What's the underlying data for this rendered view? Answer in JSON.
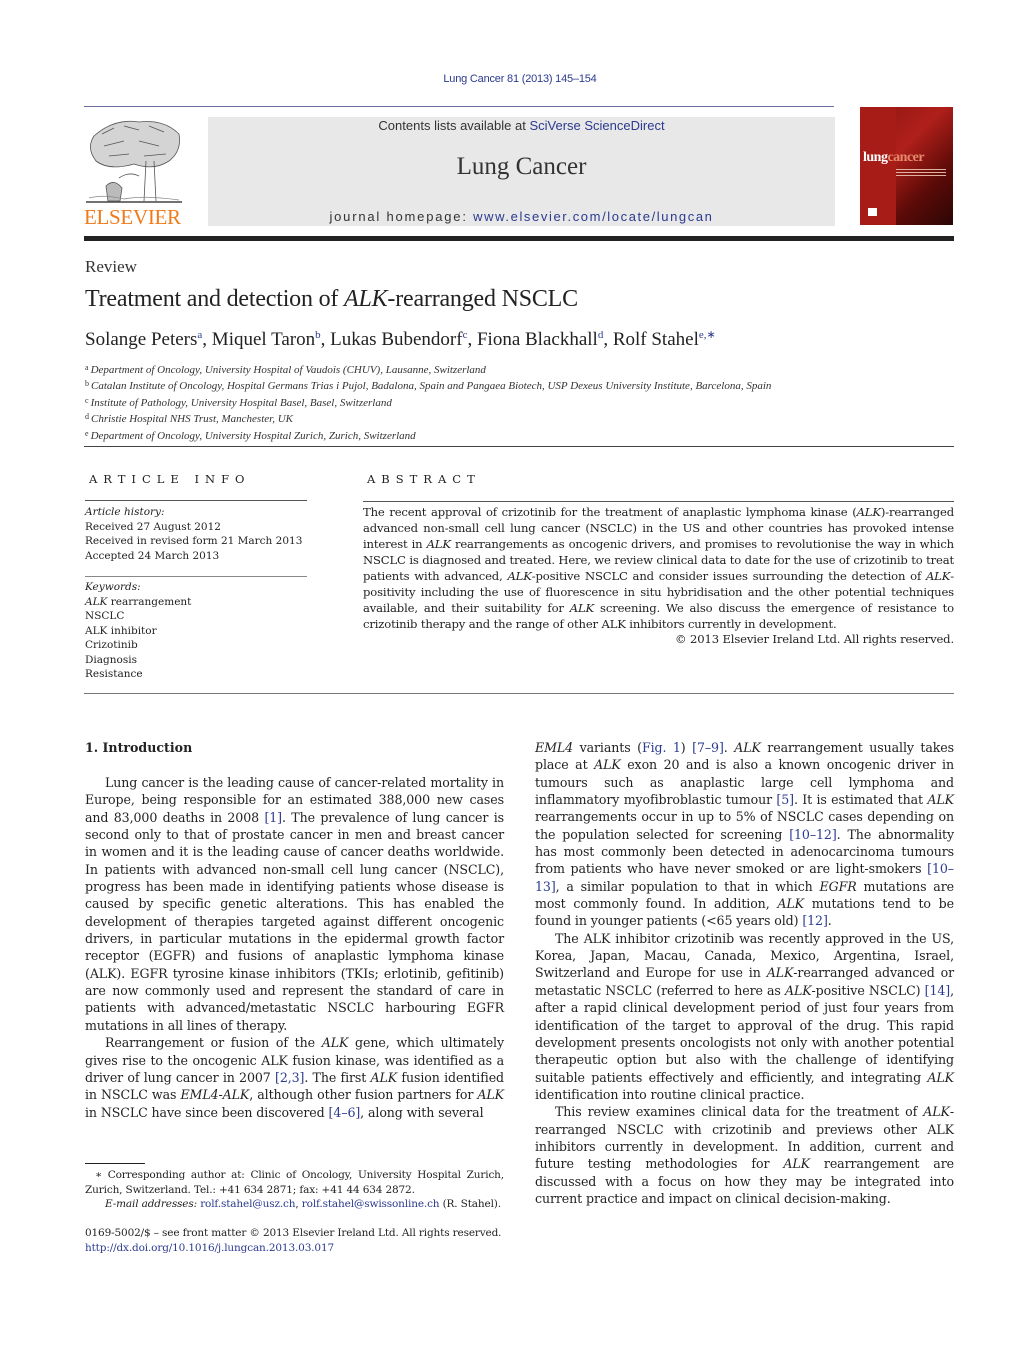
{
  "header": {
    "journal_ref": "Lung Cancer 81 (2013) 145–154",
    "contents_prefix": "Contents lists available at ",
    "contents_link": "SciVerse ScienceDirect",
    "journal_name": "Lung Cancer",
    "homepage_prefix": "journal homepage: ",
    "homepage_link": "www.elsevier.com/locate/lungcan",
    "publisher_logo_text": "ELSEVIER",
    "cover_title_a": "lung",
    "cover_title_b": "cancer",
    "colors": {
      "link": "#2b3a8f",
      "publisher": "#f07a1a",
      "header_box": "#e8e8e8",
      "cover": "#a81c17"
    }
  },
  "article": {
    "type": "Review",
    "title_pre": "Treatment and detection of ",
    "title_italic": "ALK",
    "title_post": "-rearranged NSCLC",
    "authors": [
      {
        "name": "Solange Peters",
        "sup": "a",
        "sep": ", "
      },
      {
        "name": "Miquel Taron",
        "sup": "b",
        "sep": ", "
      },
      {
        "name": "Lukas Bubendorf",
        "sup": "c",
        "sep": ", "
      },
      {
        "name": "Fiona Blackhall",
        "sup": "d",
        "sep": ", "
      },
      {
        "name": "Rolf Stahel",
        "sup": "e,∗",
        "sep": ""
      }
    ],
    "affiliations": [
      {
        "key": "a",
        "text": "Department of Oncology, University Hospital of Vaudois (CHUV), Lausanne, Switzerland"
      },
      {
        "key": "b",
        "text": "Catalan Institute of Oncology, Hospital Germans Trias i Pujol, Badalona, Spain and Pangaea Biotech, USP Dexeus University Institute, Barcelona, Spain"
      },
      {
        "key": "c",
        "text": "Institute of Pathology, University Hospital Basel, Basel, Switzerland"
      },
      {
        "key": "d",
        "text": "Christie Hospital NHS Trust, Manchester, UK"
      },
      {
        "key": "e",
        "text": "Department of Oncology, University Hospital Zurich, Zurich, Switzerland"
      }
    ]
  },
  "article_info": {
    "heading": "ARTICLE INFO",
    "history_label": "Article history:",
    "history": [
      "Received 27 August 2012",
      "Received in revised form 21 March 2013",
      "Accepted 24 March 2013"
    ],
    "keywords_label": "Keywords:",
    "keyword_1_italic": "ALK",
    "keyword_1_rest": " rearrangement",
    "keywords": [
      "NSCLC",
      "ALK inhibitor",
      "Crizotinib",
      "Diagnosis",
      "Resistance"
    ]
  },
  "abstract": {
    "heading": "ABSTRACT",
    "segments": [
      {
        "t": "The recent approval of crizotinib for the treatment of anaplastic lymphoma kinase ("
      },
      {
        "t": "ALK",
        "i": true
      },
      {
        "t": ")-rearranged advanced non-small cell lung cancer (NSCLC) in the US and other countries has provoked intense interest in "
      },
      {
        "t": "ALK",
        "i": true
      },
      {
        "t": " rearrangements as oncogenic drivers, and promises to revolutionise the way in which NSCLC is diagnosed and treated. Here, we review clinical data to date for the use of crizotinib to treat patients with advanced, "
      },
      {
        "t": "ALK",
        "i": true
      },
      {
        "t": "-positive NSCLC and consider issues surrounding the detection of "
      },
      {
        "t": "ALK",
        "i": true
      },
      {
        "t": "-positivity including the use of fluorescence in situ hybridisation and the other potential techniques available, and their suit­ability for "
      },
      {
        "t": "ALK",
        "i": true
      },
      {
        "t": " screening. We also discuss the emergence of resistance to crizotinib therapy and the range of other ALK inhibitors currently in development."
      }
    ],
    "copyright": "© 2013 Elsevier Ireland Ltd. All rights reserved."
  },
  "body": {
    "section_heading": "1.  Introduction",
    "left_paragraphs": [
      {
        "indent": true,
        "segments": [
          {
            "t": "Lung cancer is the leading cause of cancer-related mortality in Europe, being responsible for an estimated 388,000 new cases and 83,000 deaths in 2008 "
          },
          {
            "t": "[1]",
            "link": true
          },
          {
            "t": ". The prevalence of lung cancer is second only to that of prostate cancer in men and breast cancer in women and it is the leading cause of cancer deaths worldwide. In patients with advanced non-small cell lung cancer (NSCLC), progress has been made in identifying patients whose disease is caused by specific genetic alterations. This has enabled the development of therapies targeted against different oncogenic drivers, in particular mutations in the epidermal growth factor receptor (EGFR) and fusions of anaplastic lymphoma kinase (ALK). EGFR tyrosine kinase inhibitors (TKIs; erlotinib, gefitinib) are now commonly used and represent the standard of care in patients with advanced/metastatic NSCLC harbouring EGFR mutations in all lines of therapy."
          }
        ]
      },
      {
        "indent": true,
        "segments": [
          {
            "t": "Rearrangement or fusion of the "
          },
          {
            "t": "ALK",
            "i": true
          },
          {
            "t": " gene, which ultimately gives rise to the oncogenic ALK fusion kinase, was identified as a driver of lung cancer in 2007 "
          },
          {
            "t": "[2,3]",
            "link": true
          },
          {
            "t": ". The first "
          },
          {
            "t": "ALK",
            "i": true
          },
          {
            "t": " fusion identified in NSCLC was "
          },
          {
            "t": "EML4-ALK",
            "i": true
          },
          {
            "t": ", although other fusion partners for "
          },
          {
            "t": "ALK",
            "i": true
          },
          {
            "t": " in NSCLC have since been discovered "
          },
          {
            "t": "[4–6]",
            "link": true
          },
          {
            "t": ", along with several"
          }
        ]
      }
    ],
    "right_paragraphs": [
      {
        "indent": false,
        "segments": [
          {
            "t": "EML4",
            "i": true
          },
          {
            "t": " variants ("
          },
          {
            "t": "Fig. 1",
            "link": true
          },
          {
            "t": ") "
          },
          {
            "t": "[7–9]",
            "link": true
          },
          {
            "t": ". "
          },
          {
            "t": "ALK",
            "i": true
          },
          {
            "t": " rearrangement usually takes place at "
          },
          {
            "t": "ALK",
            "i": true
          },
          {
            "t": " exon 20 and is also a known oncogenic driver in tumours such as anaplastic large cell lymphoma and inflammatory myofibroblastic tumour "
          },
          {
            "t": "[5]",
            "link": true
          },
          {
            "t": ". It is estimated that "
          },
          {
            "t": "ALK",
            "i": true
          },
          {
            "t": " rearrangements occur in up to 5% of NSCLC cases depending on the population selected for screening "
          },
          {
            "t": "[10–12]",
            "link": true
          },
          {
            "t": ". The abnormality has most commonly been detected in adenocarcinoma tumours from patients who have never smoked or are light-smokers "
          },
          {
            "t": "[10–13]",
            "link": true
          },
          {
            "t": ", a similar population to that in which "
          },
          {
            "t": "EGFR",
            "i": true
          },
          {
            "t": " mutations are most commonly found. In addition, "
          },
          {
            "t": "ALK",
            "i": true
          },
          {
            "t": " mutations tend to be found in younger patients (<65 years old) "
          },
          {
            "t": "[12]",
            "link": true
          },
          {
            "t": "."
          }
        ]
      },
      {
        "indent": true,
        "segments": [
          {
            "t": "The ALK inhibitor crizotinib was recently approved in the US, Korea, Japan, Macau, Canada, Mexico, Argentina, Israel, Switzerland and Europe for use in "
          },
          {
            "t": "ALK",
            "i": true
          },
          {
            "t": "-rearranged advanced or metastatic NSCLC (referred to here as "
          },
          {
            "t": "ALK",
            "i": true
          },
          {
            "t": "-positive NSCLC) "
          },
          {
            "t": "[14]",
            "link": true
          },
          {
            "t": ", after a rapid clinical development period of just four years from identification of the target to approval of the drug. This rapid development presents oncologists not only with another potential therapeutic option but also with the challenge of identifying suitable patients effectively and efficiently, and integrating "
          },
          {
            "t": "ALK",
            "i": true
          },
          {
            "t": " identification into routine clinical practice."
          }
        ]
      },
      {
        "indent": true,
        "segments": [
          {
            "t": "This review examines clinical data for the treatment of "
          },
          {
            "t": "ALK",
            "i": true
          },
          {
            "t": "-rearranged NSCLC with crizotinib and previews other ALK inhibitors currently in development. In addition, current and future testing methodologies for "
          },
          {
            "t": "ALK",
            "i": true
          },
          {
            "t": " rearrangement are discussed with a focus on how they may be integrated into current practice and impact on clinical decision-making."
          }
        ]
      }
    ]
  },
  "footnote": {
    "corresponding": "∗ Corresponding author at: Clinic of Oncology, University Hospital Zurich, Zurich, Switzerland. Tel.: +41 634 2871; fax: +41 44 634 2872.",
    "email_label": "E-mail addresses:",
    "email_1": "rolf.stahel@usz.ch",
    "email_sep": ", ",
    "email_2": "rolf.stahel@swissonline.ch",
    "email_suffix": " (R. Stahel).",
    "front_matter": "0169-5002/$ – see front matter © 2013 Elsevier Ireland Ltd. All rights reserved.",
    "doi": "http://dx.doi.org/10.1016/j.lungcan.2013.03.017"
  }
}
